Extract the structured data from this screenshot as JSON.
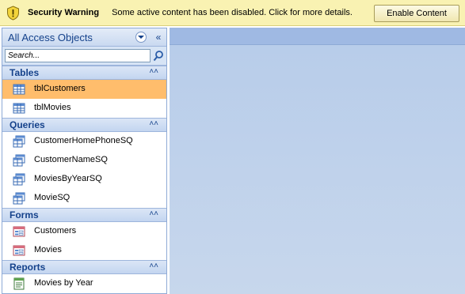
{
  "security_bar": {
    "title": "Security Warning",
    "message": "Some active content has been disabled. Click for more details.",
    "enable_button": "Enable Content"
  },
  "nav": {
    "header": "All Access Objects",
    "search_placeholder": "Search...",
    "groups": [
      {
        "label": "Tables",
        "items": [
          {
            "label": "tblCustomers",
            "icon": "table-icon",
            "selected": true
          },
          {
            "label": "tblMovies",
            "icon": "table-icon"
          }
        ]
      },
      {
        "label": "Queries",
        "items": [
          {
            "label": "CustomerHomePhoneSQ",
            "icon": "query-icon"
          },
          {
            "label": "CustomerNameSQ",
            "icon": "query-icon"
          },
          {
            "label": "MoviesByYearSQ",
            "icon": "query-icon"
          },
          {
            "label": "MovieSQ",
            "icon": "query-icon"
          }
        ]
      },
      {
        "label": "Forms",
        "items": [
          {
            "label": "Customers",
            "icon": "form-icon"
          },
          {
            "label": "Movies",
            "icon": "form-icon"
          }
        ]
      },
      {
        "label": "Reports",
        "items": [
          {
            "label": "Movies by Year",
            "icon": "report-icon"
          }
        ]
      }
    ]
  },
  "colors": {
    "selected": "#ffbd6c",
    "group_header_text": "#15428b",
    "security_bar": "#f9f2b2"
  }
}
